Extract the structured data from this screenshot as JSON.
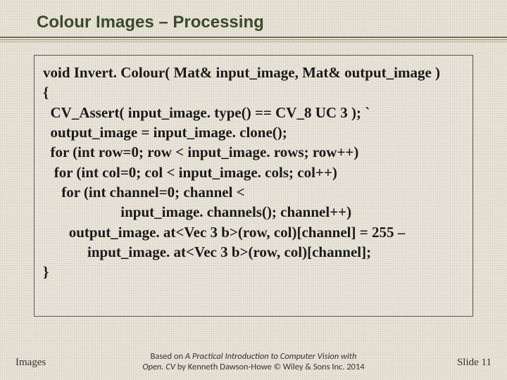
{
  "title": "Colour Images – Processing",
  "code": {
    "l1": "void Invert. Colour( Mat& input_image, Mat& output_image )",
    "l2": "{",
    "l3": "  CV_Assert( input_image. type() == CV_8 UC 3 ); `",
    "l4": "  output_image = input_image. clone();",
    "l5": "  for (int row=0; row < input_image. rows; row++)",
    "l6": "   for (int col=0; col < input_image. cols; col++)",
    "l7": "     for (int channel=0; channel <",
    "l8": "                     input_image. channels(); channel++)",
    "l9": "       output_image. at<Vec 3 b>(row, col)[channel] = 255 –",
    "l10": "            input_image. at<Vec 3 b>(row, col)[channel];",
    "l11": "}"
  },
  "footer": {
    "left": "Images",
    "center_prefix": "Based on  ",
    "center_italic1": "A Practical Introduction to Computer Vision with",
    "center_italic2": "Open. CV",
    "center_suffix": "  by Kenneth Dawson-Howe © Wiley & Sons Inc. 2014",
    "right": "Slide 11"
  }
}
